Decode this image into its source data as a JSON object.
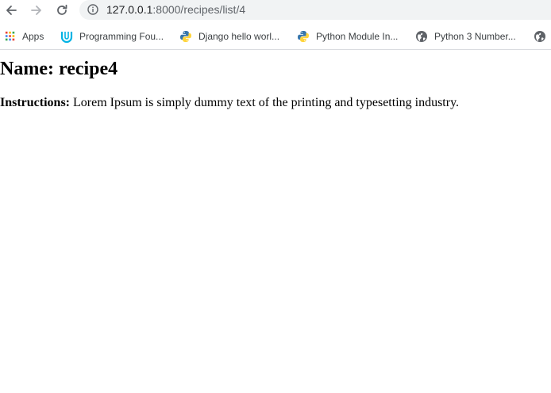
{
  "browser": {
    "url_host": "127.0.0.1",
    "url_rest": ":8000/recipes/list/4",
    "icons": {
      "back": "arrow-left-icon",
      "forward": "arrow-right-icon",
      "reload": "reload-icon",
      "info": "info-icon"
    }
  },
  "bookmarks": [
    {
      "label": "Apps",
      "icon": "apps-grid-icon"
    },
    {
      "label": "Programming Fou...",
      "icon": "udacity-icon"
    },
    {
      "label": "Django hello worl...",
      "icon": "python-icon"
    },
    {
      "label": "Python Module In...",
      "icon": "python-icon"
    },
    {
      "label": "Python 3 Number...",
      "icon": "globe-icon"
    },
    {
      "label": "",
      "icon": "globe-icon"
    }
  ],
  "recipe": {
    "title_prefix": "Name: ",
    "name": "recipe4",
    "instructions_label": "Instructions:",
    "instructions_text": " Lorem Ipsum is simply dummy text of the printing and typesetting industry."
  },
  "colors": {
    "omnibox_bg": "#f1f3f4",
    "apps_red": "#ea4335",
    "apps_yellow": "#fbbc04",
    "apps_green": "#34a853",
    "apps_blue": "#4285f4",
    "udacity_blue": "#02b3e4",
    "python_blue": "#3776ab",
    "python_yellow": "#ffd43b"
  }
}
